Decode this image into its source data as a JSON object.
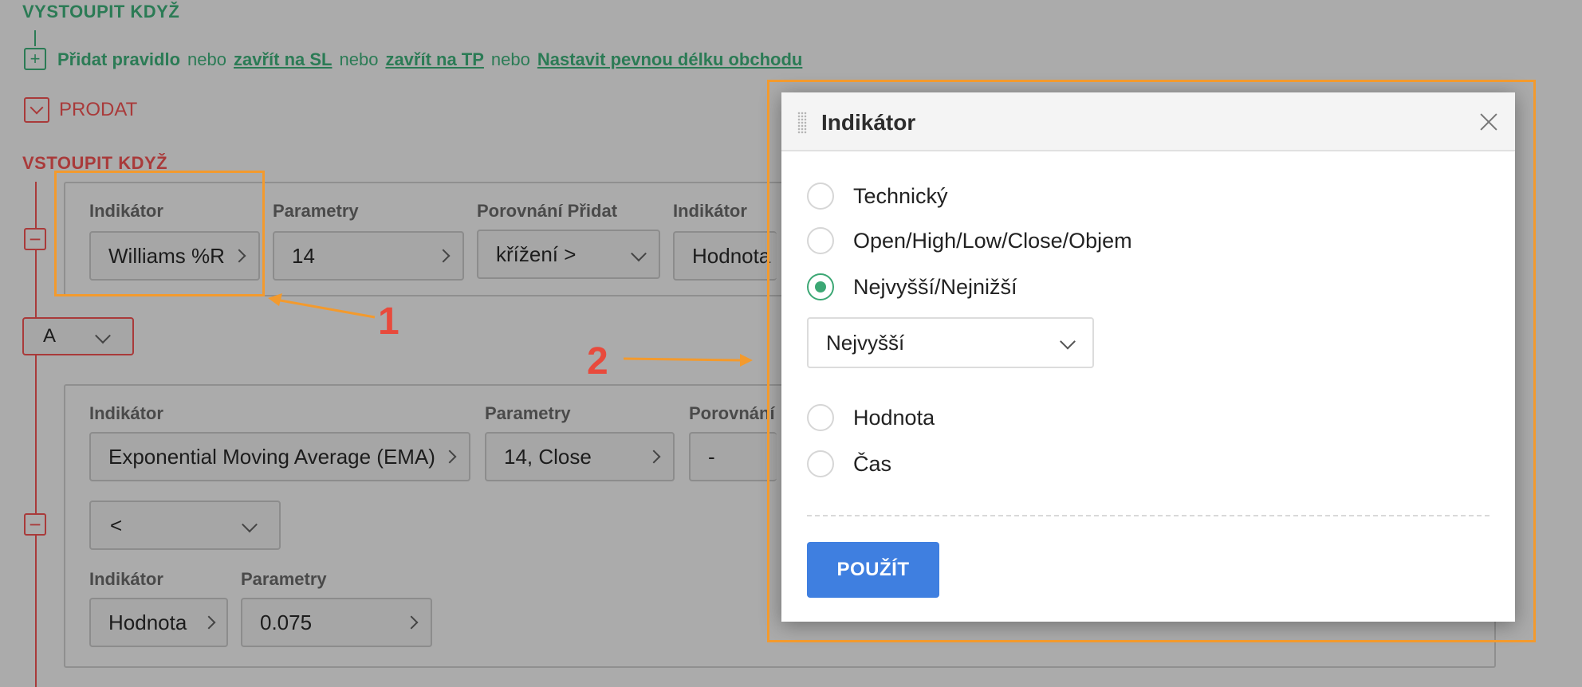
{
  "exit_section": {
    "title": "VYSTOUPIT KDYŽ",
    "add_rule": "Přidat pravidlo",
    "or1": "nebo",
    "close_sl": "zavřít na SL",
    "or2": "nebo",
    "close_tp": "zavřít na TP",
    "or3": "nebo",
    "fixed_length": "Nastavit pevnou délku obchodu"
  },
  "sell": {
    "label": "PRODAT"
  },
  "enter_section": {
    "title": "VSTOUPIT KDYŽ"
  },
  "rule1": {
    "indicator_label": "Indikátor",
    "indicator_value": "Williams %R",
    "params_label": "Parametry",
    "params_value": "14",
    "compare_label": "Porovnání Přidat",
    "compare_value": "křížení >",
    "indicator2_label": "Indikátor",
    "indicator2_value": "Hodnota"
  },
  "logic_select": {
    "value": "A"
  },
  "rule2": {
    "indicator_label": "Indikátor",
    "indicator_value": "Exponential Moving Average (EMA)",
    "params_label": "Parametry",
    "params_value": "14, Close",
    "compare_label": "Porovnání",
    "compare_value": "-",
    "operator_value": "<",
    "indicator2_label": "Indikátor",
    "indicator2_value": "Hodnota",
    "params2_label": "Parametry",
    "params2_value": "0.075"
  },
  "annotations": {
    "one": "1",
    "two": "2"
  },
  "modal": {
    "title": "Indikátor",
    "options": [
      "Technický",
      "Open/High/Low/Close/Objem",
      "Nejvyšší/Nejnižší",
      "Hodnota",
      "Čas"
    ],
    "selected_option": "Nejvyšší/Nejnižší",
    "sub_select_value": "Nejvyšší",
    "apply_label": "POUŽÍT"
  },
  "colors": {
    "green": "#2b7b55",
    "red": "#a93a3a",
    "annotation_orange": "#f39a2d",
    "annotation_number": "#e84a3c",
    "radio_selected": "#3ca774",
    "apply_button": "#3f7fe0"
  }
}
